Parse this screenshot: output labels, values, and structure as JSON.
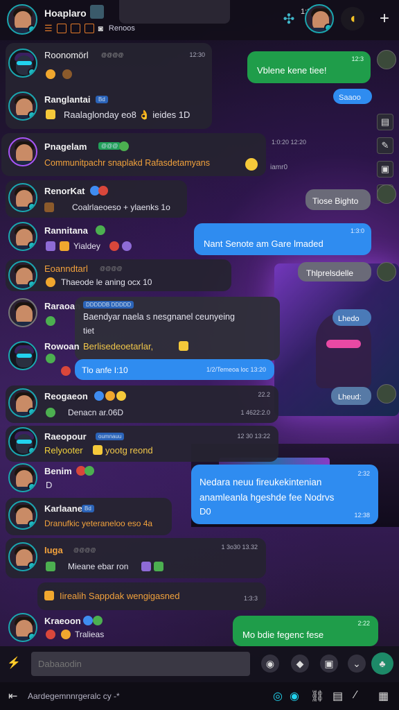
{
  "header": {
    "name": "Hoaplaro",
    "time": "1:3:K",
    "status": "Renoos"
  },
  "messages": [
    {
      "name": "Roonomörl",
      "tag": "@@@@",
      "time": "12:30",
      "text": ""
    },
    {
      "name": "Ranglantai",
      "tag": "Bd",
      "text": "Raalaglonday eo8 👌 ieides 1D"
    },
    {
      "name": "Pnagelam",
      "tag": "@@@",
      "time": "1:0:20 12:20",
      "text": "Communitpachr snaplakd Rafasdetamyans",
      "extra": "iamr0"
    },
    {
      "name": "RenorKat",
      "text": "Coalrlaeoeso + ylaenks 1o"
    },
    {
      "name": "Rannitana",
      "text": "Yialdey"
    },
    {
      "name": "Eoanndtarl",
      "tag": "@@@@",
      "text": "Thaeode le aning ocx 10"
    },
    {
      "name": "Raraoan",
      "tag": "DDDDDB DDDDD",
      "text": "Baendyar naela s nesgnanel ceunyeing",
      "text2": "Berlisedeoetarlar,",
      "sub": "tiet"
    },
    {
      "name": "Rowoan",
      "text": ""
    },
    {
      "name": "Reogaeon",
      "time": "22.2",
      "text": "Denacn ar.06D",
      "time2": "1 4622:2.0"
    },
    {
      "name": "Raeopour",
      "tag": "oumnauu",
      "text": "Relyooter",
      "text2": "yootg reond",
      "time": "12 30  13:22"
    },
    {
      "name": "Benim",
      "text": "D"
    },
    {
      "name": "Karlaane",
      "tag": "Bd",
      "text": "Dranufkic yeteraneloo eso 4a"
    },
    {
      "name": "Iuga",
      "tag": "@@@@",
      "time": "1 3o30 13.32",
      "text": "Mieane ebar ron"
    },
    {
      "name": "",
      "text": "Iirealih  Sappdak wengigasned",
      "time": "1:3:3"
    },
    {
      "name": "Kraeoon",
      "text": "Tralieas"
    }
  ],
  "outgoing": [
    {
      "text": "Vblene kene tiee!",
      "time": "12:3"
    },
    {
      "text": "Saaoo"
    },
    {
      "text": "Tiose Bighto"
    },
    {
      "text": "Nant Senote am Gare lmaded",
      "time": "1:3:0"
    },
    {
      "text": "Thlprelsdelle"
    },
    {
      "text": "Lhedo"
    },
    {
      "text": "Lheud:"
    },
    {
      "text": "Tlo anfe I:10",
      "time": "1/2/Temeoa loc  13:20"
    },
    {
      "text": "Nedara neuu fireukekintenian",
      "text2": "anamleanla hgeshde fee Nodrvs",
      "text3": "D0",
      "time": "12:38",
      "time2": "2:32"
    },
    {
      "text": "Mo bdie fegenc fese",
      "time": "2:22"
    }
  ],
  "composer": {
    "placeholder": "Dabaaodin"
  },
  "bottom": {
    "label": "Aardegemnnrgeralc cy -*"
  },
  "side_icons": [
    "file-icon",
    "edit-icon",
    "image-icon",
    "book-icon"
  ]
}
